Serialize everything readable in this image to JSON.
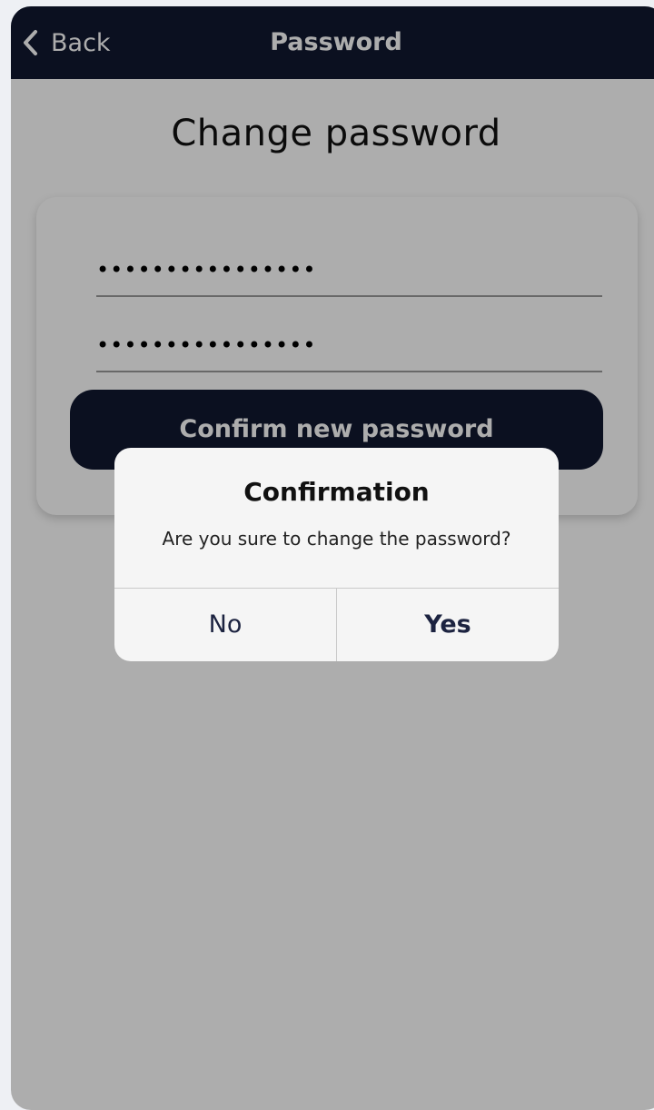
{
  "navbar": {
    "back_label": "Back",
    "title": "Password",
    "back_icon": "chevron-left-icon"
  },
  "main": {
    "title": "Change password",
    "fields": [
      {
        "value": "••••••••••••••••"
      },
      {
        "value": "••••••••••••••••"
      }
    ],
    "confirm_label": "Confirm new password"
  },
  "dialog": {
    "title": "Confirmation",
    "message": "Are you sure to change the password?",
    "no_label": "No",
    "yes_label": "Yes"
  },
  "colors": {
    "navbar_bg": "#111830",
    "button_bg": "#111830",
    "overlay": "rgba(0,0,0,0.32)",
    "dialog_bg": "#f5f5f5"
  }
}
